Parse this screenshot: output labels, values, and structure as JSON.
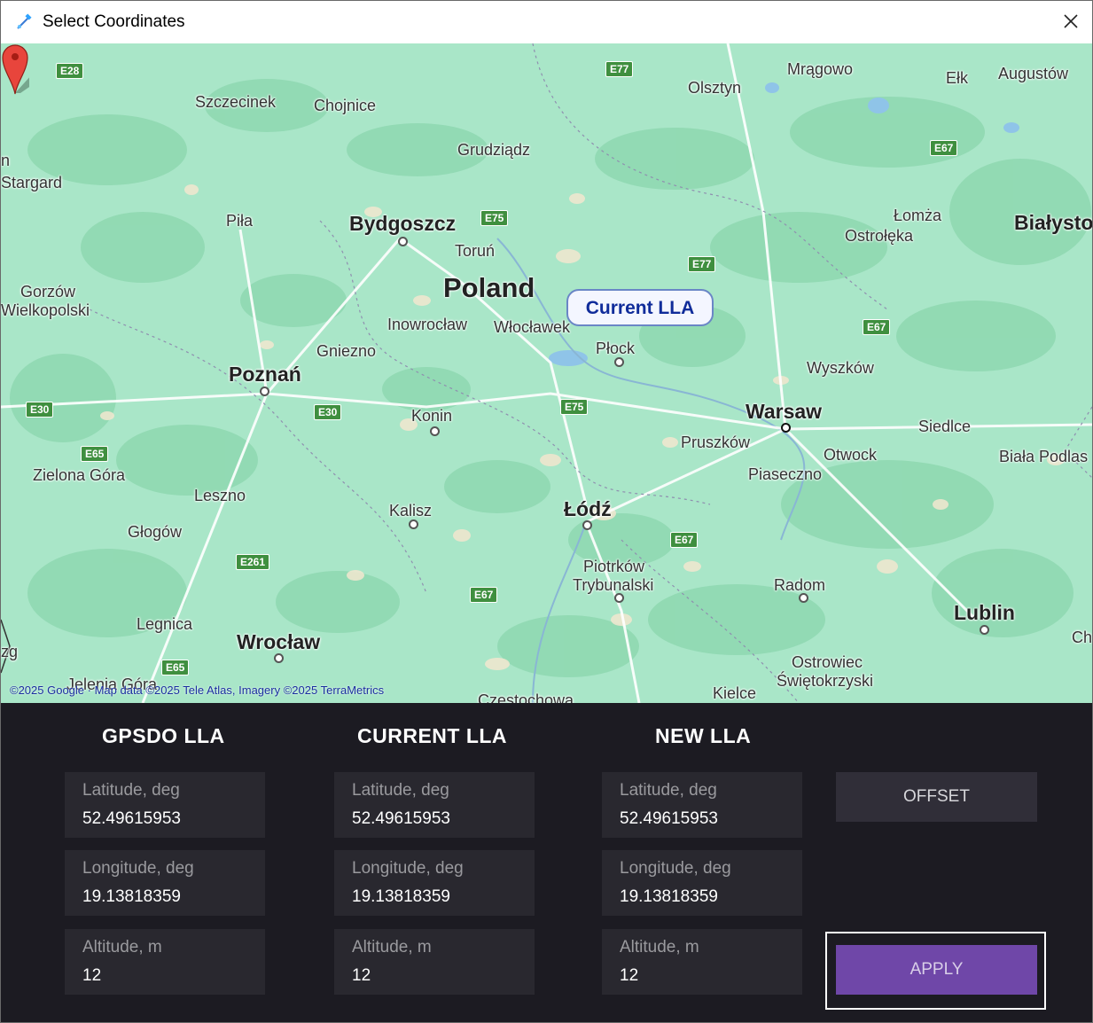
{
  "window": {
    "title": "Select Coordinates",
    "close_icon": "close-icon",
    "app_icon": "satellite-icon"
  },
  "map": {
    "country_label": "Poland",
    "marker_label": "Current LLA",
    "attribution": "©2025 Google · Map data ©2025 Tele Atlas, Imagery ©2025 TerraMetrics",
    "big_cities": {
      "bydgoszcz": "Bydgoszcz",
      "poznan": "Poznań",
      "warsaw": "Warsaw",
      "lodz": "Łódź",
      "wroclaw": "Wrocław",
      "lublin": "Lublin",
      "bialystok": "Białysto"
    },
    "cities": {
      "szczecinek": "Szczecinek",
      "chojnice": "Chojnice",
      "grudziadz": "Grudziądz",
      "olsztyn": "Olsztyn",
      "mragowo": "Mrągowo",
      "elk": "Ełk",
      "augustow": "Augustów",
      "stargard": "Stargard",
      "pila": "Piła",
      "torun": "Toruń",
      "lomza": "Łomża",
      "ostroleka": "Ostrołęka",
      "gorzow": "Gorzów",
      "wielkopolski": "Wielkopolski",
      "inowroclaw": "Inowrocław",
      "wloclawek": "Włocławek",
      "plock": "Płock",
      "gniezno": "Gniezno",
      "wyszkow": "Wyszków",
      "konin": "Konin",
      "siedlce": "Siedlce",
      "pruszkow": "Pruszków",
      "otwock": "Otwock",
      "biala_podlaska": "Biała Podlas",
      "piaseczno": "Piaseczno",
      "zielona_gora": "Zielona Góra",
      "leszno": "Leszno",
      "kalisz": "Kalisz",
      "glogow": "Głogów",
      "piotrkow": "Piotrków",
      "trybunalski": "Trybunalski",
      "radom": "Radom",
      "legnica": "Legnica",
      "ostrowiec": "Ostrowiec",
      "swietokrzyski": "Świętokrzyski",
      "jelenia_gora": "Jelenia Góra",
      "kielce": "Kielce",
      "czestochowa": "Częstochowa",
      "ch": "Ch",
      "n": "n",
      "zg": "zg"
    },
    "roads": {
      "e28": "E28",
      "e77a": "E77",
      "e67a": "E67",
      "e75a": "E75",
      "e77b": "E77",
      "e67b": "E67",
      "e30a": "E30",
      "e30b": "E30",
      "e75b": "E75",
      "e65a": "E65",
      "e67c": "E67",
      "e261": "E261",
      "e67d": "E67",
      "e65b": "E65"
    }
  },
  "columns": [
    {
      "title": "GPSDO LLA",
      "lat_label": "Latitude, deg",
      "lat": "52.49615953",
      "lon_label": "Longitude, deg",
      "lon": "19.13818359",
      "alt_label": "Altitude, m",
      "alt": "12"
    },
    {
      "title": "CURRENT LLA",
      "lat_label": "Latitude, deg",
      "lat": "52.49615953",
      "lon_label": "Longitude, deg",
      "lon": "19.13818359",
      "alt_label": "Altitude, m",
      "alt": "12"
    },
    {
      "title": "NEW LLA",
      "lat_label": "Latitude, deg",
      "lat": "52.49615953",
      "lon_label": "Longitude, deg",
      "lon": "19.13818359",
      "alt_label": "Altitude, m",
      "alt": "12"
    }
  ],
  "buttons": {
    "offset": "OFFSET",
    "apply": "APPLY"
  },
  "colors": {
    "panel_bg": "#1c1b22",
    "field_bg": "#29282f",
    "apply_accent": "#6f47a8",
    "map_land": "#a7e5c6",
    "marker": "#e8453c",
    "callout_text": "#102c9a"
  }
}
